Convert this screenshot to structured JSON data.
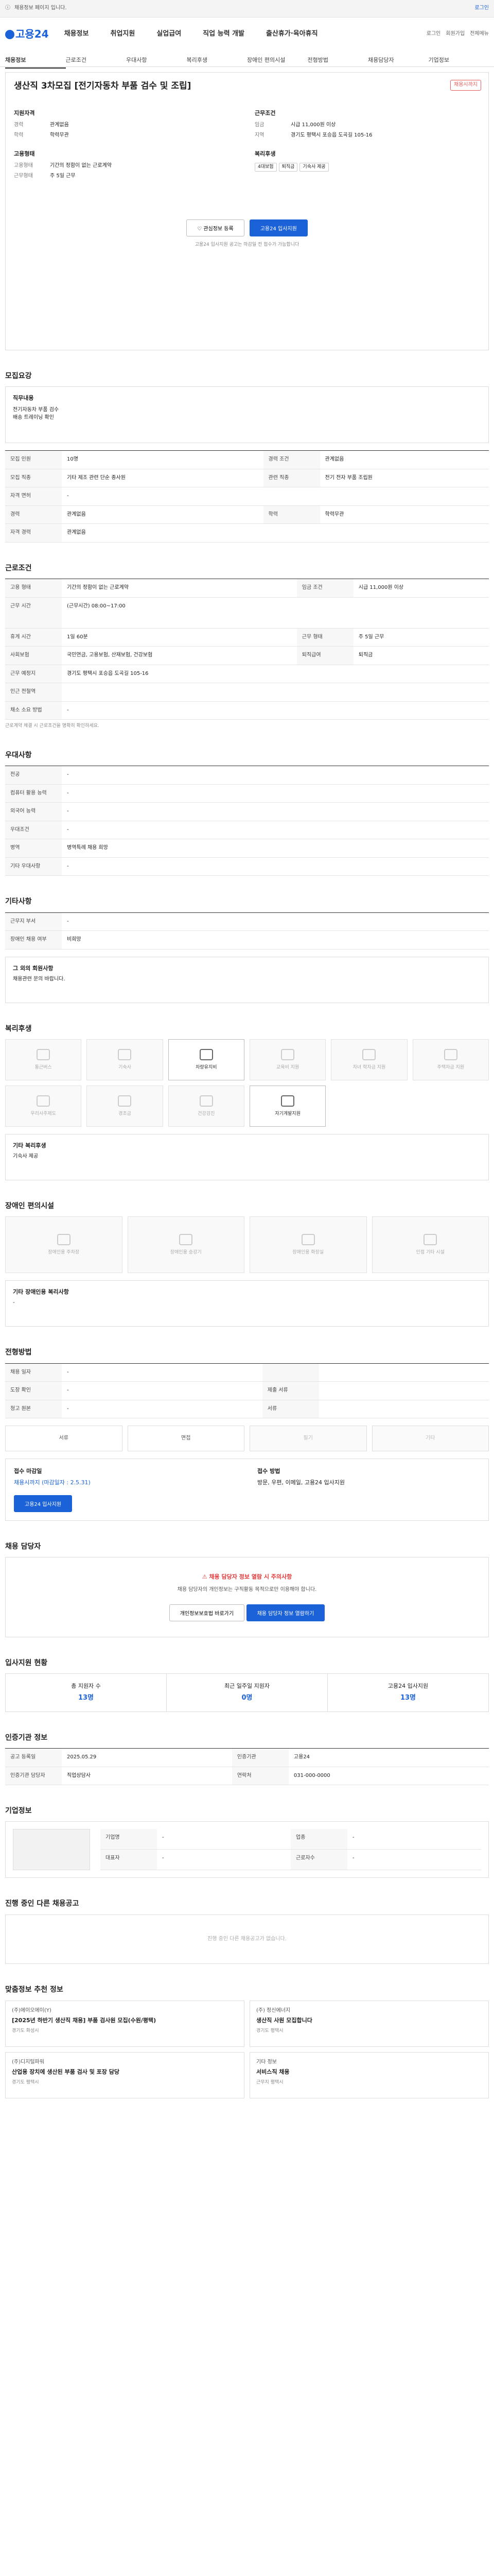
{
  "topbar": {
    "notice": "채용정보 페이지 입니다.",
    "right": "로그인"
  },
  "header": {
    "logo": "고용24",
    "nav": [
      "채용정보",
      "취업지원",
      "실업급여",
      "직업 능력 개발",
      "출산휴가·육아휴직"
    ],
    "util": [
      "로그인",
      "회원가입",
      "전체메뉴"
    ]
  },
  "subnav": [
    "채용정보",
    "근로조건",
    "우대사항",
    "복리후생",
    "장애인 편의시설",
    "전형방법",
    "채용담당자",
    "기업정보"
  ],
  "hero": {
    "title": "생산직 3차모집 [전기자동차 부품 검수 및 조립]",
    "badge": "채용시까지",
    "left_title": "지원자격",
    "left": [
      [
        "경력",
        "관계없음"
      ],
      [
        "학력",
        "학력무관"
      ]
    ],
    "left2_title": "고용형태",
    "left2": [
      [
        "고용형태",
        "기간의 정함이 없는 근로계약"
      ],
      [
        "근무형태",
        "주 5일 근무"
      ]
    ],
    "right_title": "근무조건",
    "right": [
      [
        "임금",
        "시급 11,000원 이상"
      ],
      [
        "지역",
        "경기도 평택시 포승읍 도곡길 105-16"
      ]
    ],
    "right2_title": "복리후생",
    "tags": [
      "4대보험",
      "퇴직금",
      "기숙사 제공"
    ],
    "btn_save": "관심정보 등록",
    "btn_apply": "고용24 입사지원",
    "note": "고용24 입사지원 공고는 마감일 전 접수가 가능합니다"
  },
  "sec_recruit": {
    "title": "모집요강",
    "box_title": "직무내용",
    "box_text": "전기자동차 부품 검수\n배송 트레이닝 확인",
    "rows": [
      [
        "모집 인원",
        "10명",
        "경력 조건",
        "관계없음"
      ],
      [
        "모집 직종",
        "기타 제조 관련 단순 종사원",
        "관련 직종",
        "전기 전자 부품 조립원"
      ],
      [
        "자격 면허",
        "-",
        "",
        ""
      ],
      [
        "경력",
        "관계없음",
        "학력",
        "학력무관"
      ],
      [
        "자격 경력",
        "관계없음",
        "",
        ""
      ]
    ]
  },
  "sec_cond": {
    "title": "근로조건",
    "rows": [
      [
        "고용 형태",
        "기간의 정함이 없는 근로계약",
        "임금 조건",
        "시급 11,000원 이상"
      ],
      [
        "근무 시간",
        "(근무시간) 08:00~17:00",
        "",
        ""
      ],
      [
        "휴게 시간",
        "1일 60분",
        "근무 형태",
        "주 5일 근무"
      ],
      [
        "사회보험",
        "국민연금, 고용보험, 산재보험, 건강보험",
        "퇴직급여",
        "퇴직금"
      ],
      [
        "근무 예정지",
        "경기도 평택시 포승읍 도곡길 105-16",
        "",
        ""
      ],
      [
        "인근 전철역",
        "",
        "",
        ""
      ],
      [
        "채소 소요 방법",
        "-",
        "",
        ""
      ]
    ],
    "note": "근로계약 체결 시 근로조건을 명확히 확인하세요."
  },
  "sec_pref": {
    "title": "우대사항",
    "rows": [
      [
        "전공",
        "-"
      ],
      [
        "컴퓨터 활용 능력",
        "-"
      ],
      [
        "외국어 능력",
        "-"
      ],
      [
        "우대조건",
        "-"
      ],
      [
        "병역",
        "병역특례 채용 희망"
      ],
      [
        "기타 우대사항",
        "-"
      ]
    ]
  },
  "sec_etc": {
    "title": "기타사항",
    "rows": [
      [
        "근무지 부서",
        "-"
      ],
      [
        "장애인 채용 여부",
        "비희망"
      ]
    ],
    "box_title": "그 외의 회원사항",
    "box_text": "채용관련 문의 바랍니다."
  },
  "sec_welfare": {
    "title": "복리후생",
    "items": [
      "통근버스",
      "기숙사",
      "차량유지비",
      "교육비 지원",
      "자녀 학자금 지원",
      "주택자금 지원",
      "우리사주제도",
      "경조금",
      "건강검진",
      "자기계발지원"
    ],
    "on": [
      2,
      9
    ],
    "etc_title": "기타 복리후생",
    "etc_text": "기숙사 제공"
  },
  "sec_facil": {
    "title": "장애인 편의시설",
    "items": [
      "장애인용 주차장",
      "장애인용 승강기",
      "장애인용 화장실",
      "인접 기타 시설"
    ],
    "etc_title": "기타 장애인용 복리사항",
    "etc_text": "-"
  },
  "sec_method": {
    "title": "전형방법",
    "rows": [
      [
        "채용 일자",
        "-",
        ""
      ],
      [
        "도장 확인",
        "-",
        "제출 서류"
      ],
      [
        "청고 원본",
        "-",
        "서류"
      ]
    ],
    "methods": [
      "서류",
      "면접",
      "필기",
      "기타"
    ],
    "apply_title": "접수 마감일",
    "apply_val": "채용시까지 (마감일자 : 2.5.31)",
    "apply2_title": "접수 방법",
    "apply2_val": "방문, 우편, 이메일, 고용24 입사지원",
    "btn": "고용24 입사지원"
  },
  "sec_contact": {
    "title": "채용 담당자",
    "t1": "채용 담당자 정보 열람 시 주의사항",
    "t2": "채용 담당자의 개인정보는 구직활동 목적으로만 이용해야 합니다.",
    "btn1": "개인정보보호법 바로가기",
    "btn2": "채용 담당자 정보 열람하기"
  },
  "sec_stats": {
    "title": "입사지원 현황",
    "items": [
      [
        "총 지원자 수",
        "13명"
      ],
      [
        "최근 일주일 지원자",
        "0명"
      ],
      [
        "고용24 입사지원",
        "13명"
      ]
    ]
  },
  "sec_org": {
    "title": "인증기관 정보",
    "rows": [
      [
        "공고 등록일",
        "2025.05.29",
        "인증기관",
        "고용24"
      ],
      [
        "인증기관 담당자",
        "직업상담사",
        "연락처",
        "031-000-0000"
      ]
    ]
  },
  "sec_company": {
    "title": "기업정보",
    "rows": [
      [
        "기업명",
        "-"
      ],
      [
        "업종",
        "-"
      ],
      [
        "대표자",
        "-"
      ],
      [
        "근로자수",
        "-"
      ]
    ]
  },
  "sec_other": {
    "title": "진행 중인 다른 채용공고",
    "empty": "진행 중인 다른 채용공고가 없습니다."
  },
  "sec_reco": {
    "title": "맞춤정보 추천 정보",
    "cards": [
      {
        "co": "(주)에이오에이(Y)",
        "ti": "[2025년 하반기 생산직 채용] 부품 검사원 모집(수원/평택)",
        "me": "경기도 화성시"
      },
      {
        "co": "(주) 정신에너지",
        "ti": "생산직 사원 모집합니다",
        "me": "경기도 평택시"
      },
      {
        "co": "(주)디지털파워",
        "ti": "산업용 장치에 생산된 부품 검사 및 포장 담당",
        "me": "경기도 평택시"
      },
      {
        "co": "기타 정보",
        "ti": "서비스직 채용",
        "me": "근무지 평택시"
      }
    ]
  }
}
